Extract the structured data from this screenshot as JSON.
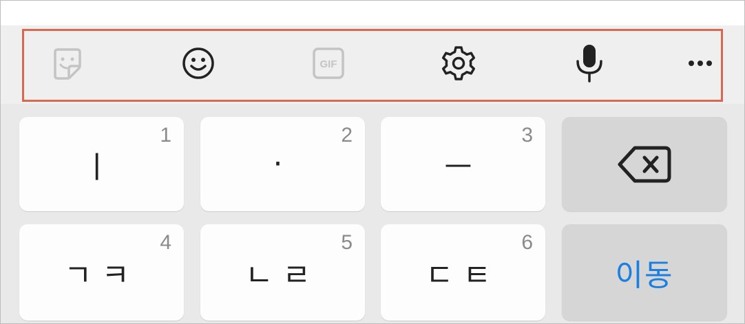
{
  "colors": {
    "toolbar_bg": "#efefef",
    "keyboard_bg": "#e9e9e9",
    "key_bg": "#fdfdfd",
    "func_key_bg": "#d6d6d6",
    "highlight": "#d9684f",
    "icon_active": "#222222",
    "icon_disabled": "#c4c4c4",
    "action_text": "#1a7fe0"
  },
  "toolbar": {
    "items": [
      {
        "icon": "sticker-icon",
        "enabled": false
      },
      {
        "icon": "emoji-icon",
        "enabled": true
      },
      {
        "icon": "gif-icon",
        "label": "GIF",
        "enabled": false
      },
      {
        "icon": "settings-icon",
        "enabled": true
      },
      {
        "icon": "microphone-icon",
        "enabled": true
      },
      {
        "icon": "more-icon",
        "enabled": true
      }
    ]
  },
  "keys": {
    "row1": [
      {
        "char": "ㅣ",
        "num": "1"
      },
      {
        "char": "·",
        "num": "2"
      },
      {
        "char": "ㅡ",
        "num": "3"
      }
    ],
    "row2": [
      {
        "char": "ㄱㅋ",
        "num": "4"
      },
      {
        "char": "ㄴㄹ",
        "num": "5"
      },
      {
        "char": "ㄷㅌ",
        "num": "6"
      }
    ],
    "backspace_icon": "backspace-icon",
    "action_label": "이동"
  }
}
